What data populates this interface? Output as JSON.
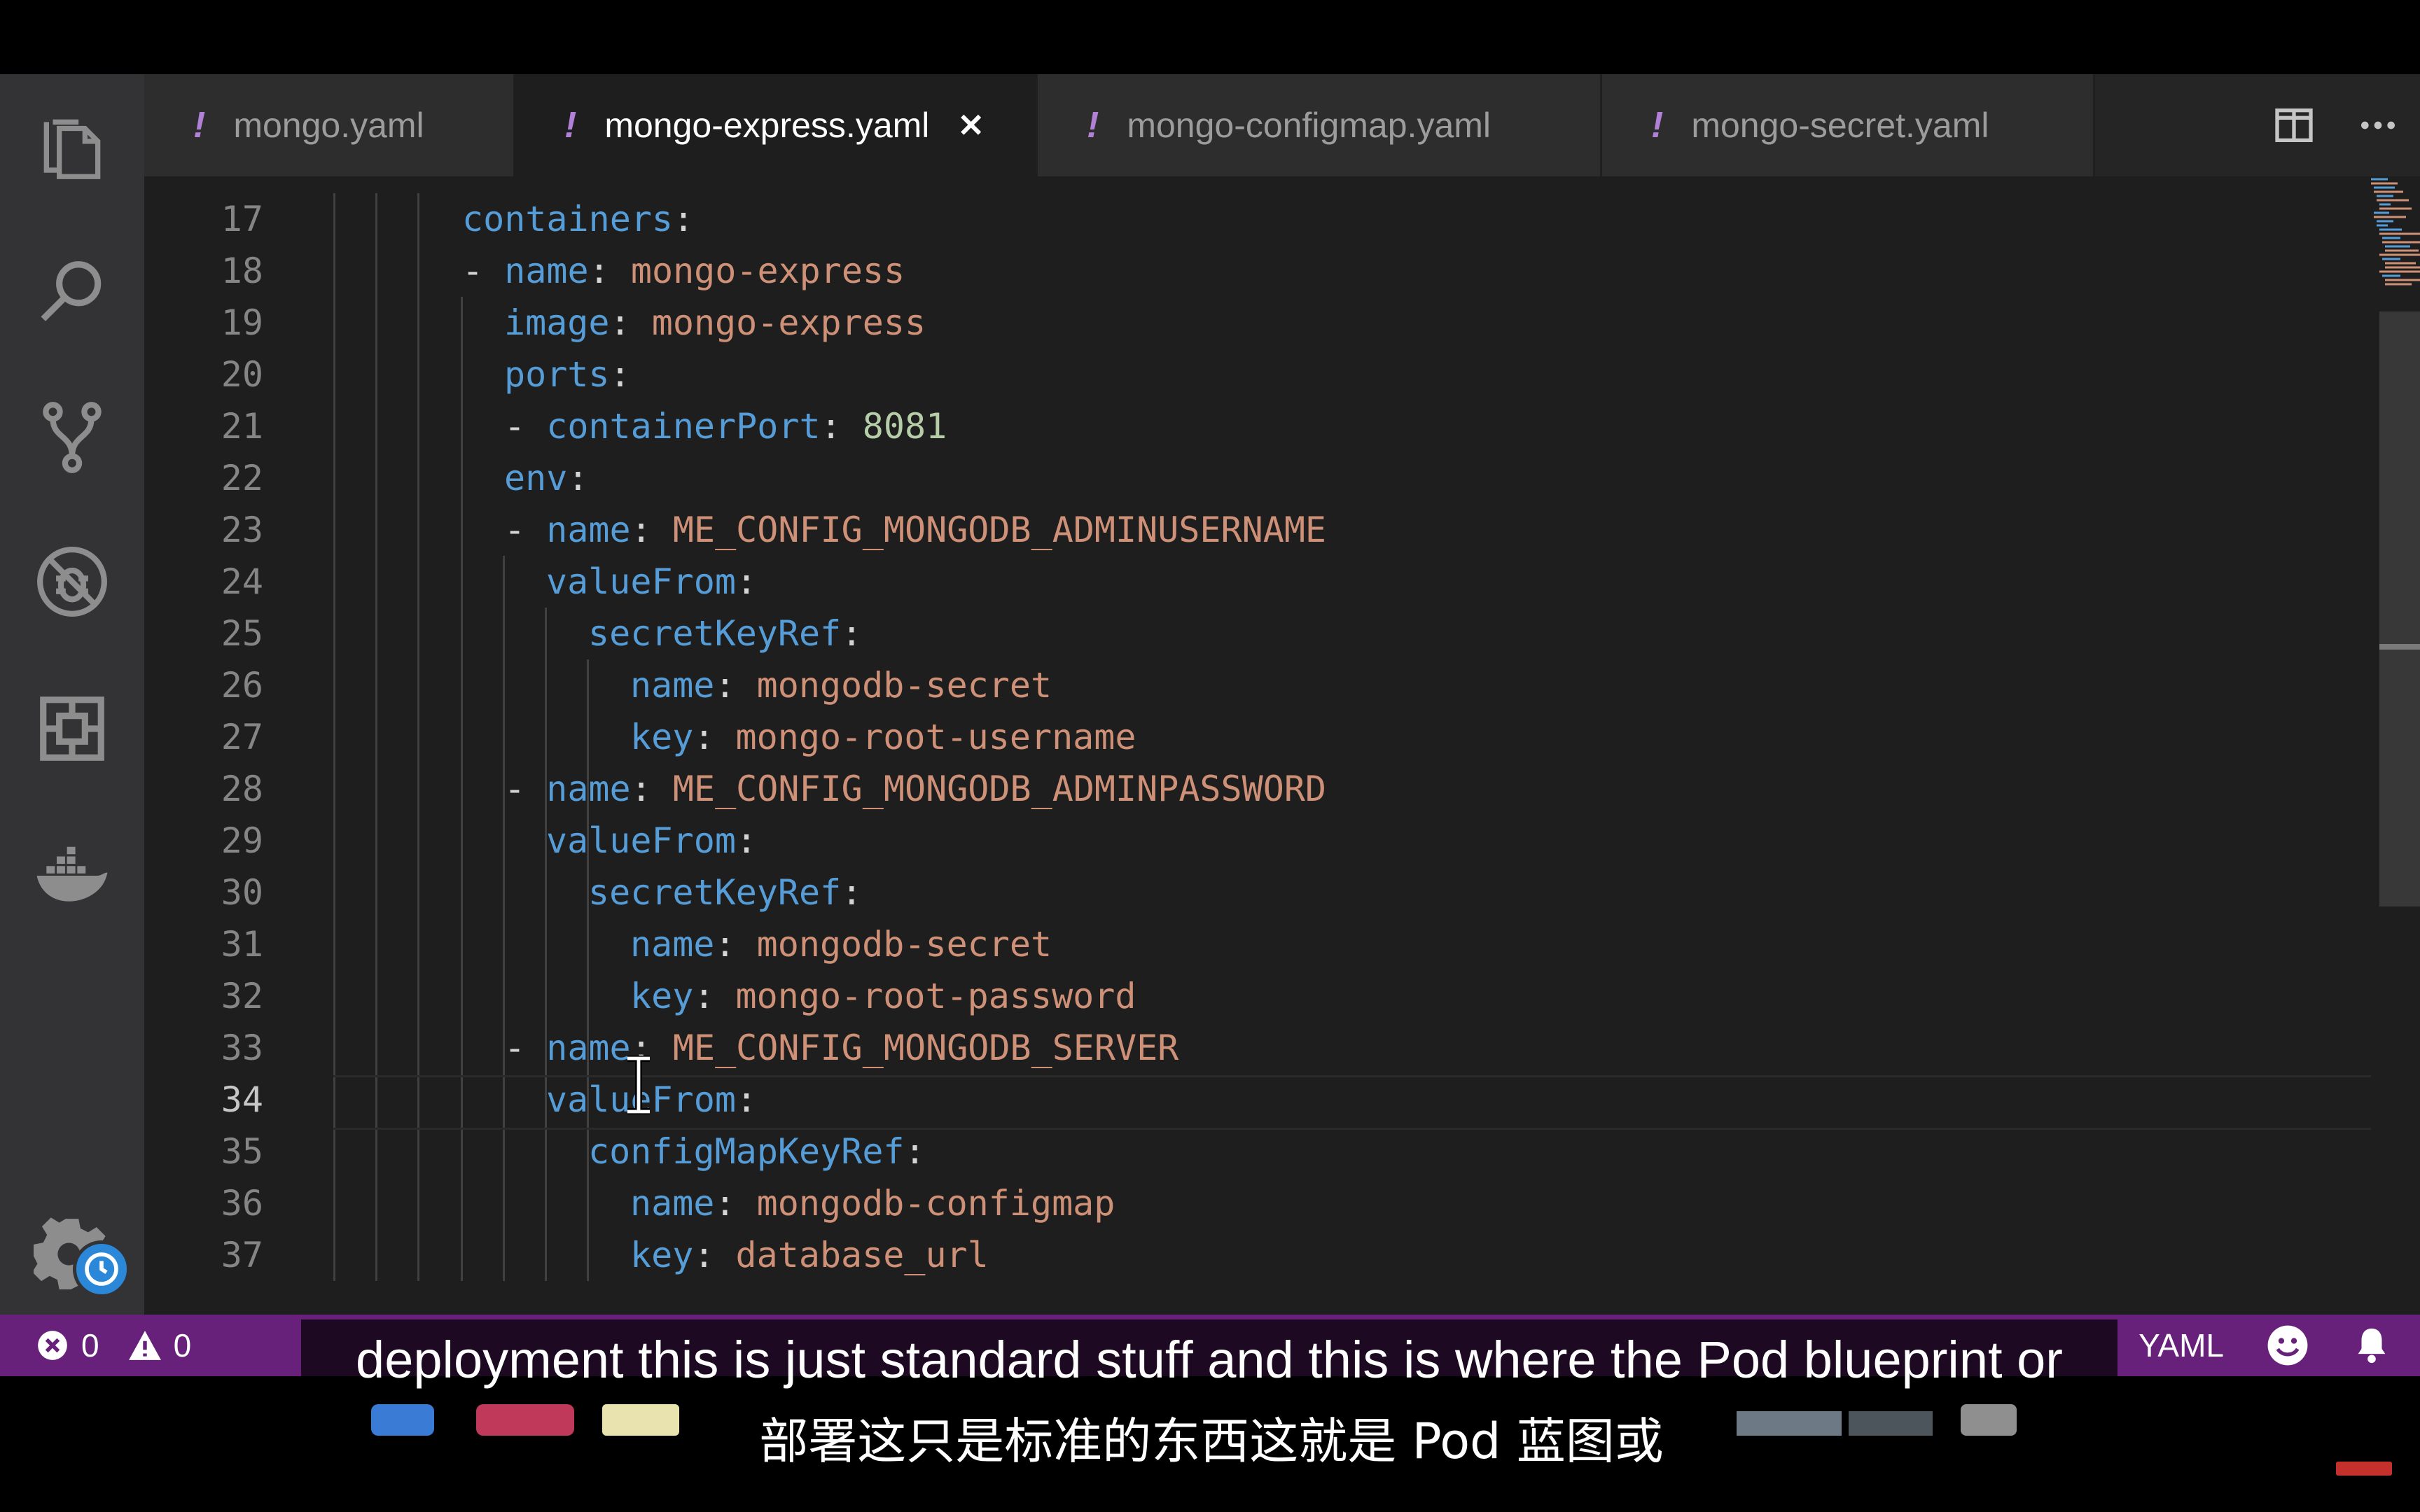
{
  "tabs": [
    {
      "label": "mongo.yaml",
      "active": false
    },
    {
      "label": "mongo-express.yaml",
      "active": true,
      "close": "✕"
    },
    {
      "label": "mongo-configmap.yaml",
      "active": false
    },
    {
      "label": "mongo-secret.yaml",
      "active": false
    }
  ],
  "tab_marker": "!",
  "editor": {
    "current_line": 34,
    "lines": [
      {
        "num": "17",
        "indent": 0,
        "parts": [
          [
            "k",
            "containers"
          ],
          [
            "p",
            ":"
          ]
        ]
      },
      {
        "num": "18",
        "indent": 0,
        "parts": [
          [
            "p",
            "- "
          ],
          [
            "k",
            "name"
          ],
          [
            "p",
            ": "
          ],
          [
            "s",
            "mongo-express"
          ]
        ]
      },
      {
        "num": "19",
        "indent": 1,
        "parts": [
          [
            "k",
            "image"
          ],
          [
            "p",
            ": "
          ],
          [
            "s",
            "mongo-express"
          ]
        ]
      },
      {
        "num": "20",
        "indent": 1,
        "parts": [
          [
            "k",
            "ports"
          ],
          [
            "p",
            ":"
          ]
        ]
      },
      {
        "num": "21",
        "indent": 1,
        "parts": [
          [
            "p",
            "- "
          ],
          [
            "k",
            "containerPort"
          ],
          [
            "p",
            ": "
          ],
          [
            "n",
            "8081"
          ]
        ]
      },
      {
        "num": "22",
        "indent": 1,
        "parts": [
          [
            "k",
            "env"
          ],
          [
            "p",
            ":"
          ]
        ]
      },
      {
        "num": "23",
        "indent": 1,
        "parts": [
          [
            "p",
            "- "
          ],
          [
            "k",
            "name"
          ],
          [
            "p",
            ": "
          ],
          [
            "s",
            "ME_CONFIG_MONGODB_ADMINUSERNAME"
          ]
        ]
      },
      {
        "num": "24",
        "indent": 2,
        "parts": [
          [
            "k",
            "valueFrom"
          ],
          [
            "p",
            ":"
          ]
        ]
      },
      {
        "num": "25",
        "indent": 3,
        "parts": [
          [
            "k",
            "secretKeyRef"
          ],
          [
            "p",
            ":"
          ]
        ]
      },
      {
        "num": "26",
        "indent": 4,
        "parts": [
          [
            "k",
            "name"
          ],
          [
            "p",
            ": "
          ],
          [
            "s",
            "mongodb-secret"
          ]
        ]
      },
      {
        "num": "27",
        "indent": 4,
        "parts": [
          [
            "k",
            "key"
          ],
          [
            "p",
            ": "
          ],
          [
            "s",
            "mongo-root-username"
          ]
        ]
      },
      {
        "num": "28",
        "indent": 1,
        "parts": [
          [
            "p",
            "- "
          ],
          [
            "k",
            "name"
          ],
          [
            "p",
            ": "
          ],
          [
            "s",
            "ME_CONFIG_MONGODB_ADMINPASSWORD"
          ]
        ]
      },
      {
        "num": "29",
        "indent": 2,
        "parts": [
          [
            "k",
            "valueFrom"
          ],
          [
            "p",
            ":"
          ]
        ]
      },
      {
        "num": "30",
        "indent": 3,
        "parts": [
          [
            "k",
            "secretKeyRef"
          ],
          [
            "p",
            ":"
          ]
        ]
      },
      {
        "num": "31",
        "indent": 4,
        "parts": [
          [
            "k",
            "name"
          ],
          [
            "p",
            ": "
          ],
          [
            "s",
            "mongodb-secret"
          ]
        ]
      },
      {
        "num": "32",
        "indent": 4,
        "parts": [
          [
            "k",
            "key"
          ],
          [
            "p",
            ": "
          ],
          [
            "s",
            "mongo-root-password"
          ]
        ]
      },
      {
        "num": "33",
        "indent": 1,
        "parts": [
          [
            "p",
            "- "
          ],
          [
            "k",
            "name"
          ],
          [
            "p",
            ": "
          ],
          [
            "s",
            "ME_CONFIG_MONGODB_SERVER"
          ]
        ]
      },
      {
        "num": "34",
        "indent": 2,
        "parts": [
          [
            "k",
            "valueFrom"
          ],
          [
            "p",
            ":"
          ]
        ]
      },
      {
        "num": "35",
        "indent": 3,
        "parts": [
          [
            "k",
            "configMapKeyRef"
          ],
          [
            "p",
            ":"
          ]
        ]
      },
      {
        "num": "36",
        "indent": 4,
        "parts": [
          [
            "k",
            "name"
          ],
          [
            "p",
            ": "
          ],
          [
            "s",
            "mongodb-configmap"
          ]
        ]
      },
      {
        "num": "37",
        "indent": 4,
        "parts": [
          [
            "k",
            "key"
          ],
          [
            "p",
            ": "
          ],
          [
            "s",
            "database_url"
          ]
        ]
      }
    ]
  },
  "statusbar": {
    "errors": "0",
    "warnings": "0",
    "language": "YAML"
  },
  "captions": {
    "english": "deployment this is just standard stuff and this is where the Pod blueprint or",
    "chinese": "部署这只是标准的东西这就是 Pod 蓝图或"
  },
  "colors": {
    "activity_bar": "#333336",
    "editor_bg": "#1e1e1e",
    "statusbar": "#68217a",
    "key": "#569cd6",
    "string": "#ce9178",
    "number": "#b5cea8",
    "yaml_marker": "#b180d7"
  },
  "icons": [
    "files-icon",
    "search-icon",
    "source-control-icon",
    "debug-icon",
    "extensions-icon",
    "docker-icon",
    "settings-gear-icon",
    "clock-badge-icon",
    "split-editor-icon",
    "more-actions-icon",
    "error-icon",
    "warning-icon",
    "feedback-smiley-icon",
    "bell-icon",
    "text-cursor-icon"
  ]
}
